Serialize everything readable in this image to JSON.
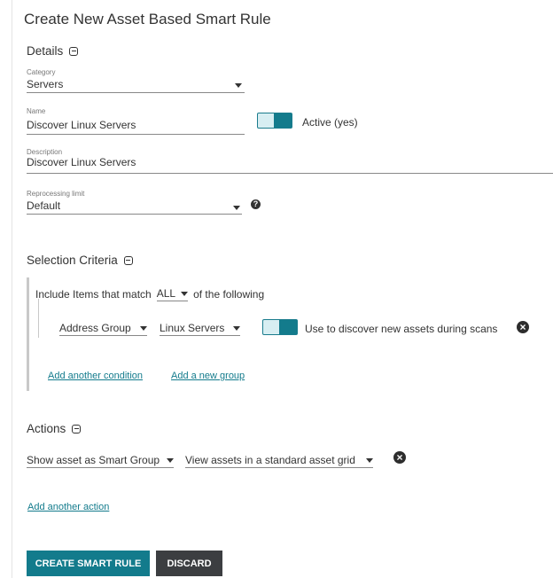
{
  "title": "Create New Asset Based Smart Rule",
  "details": {
    "heading": "Details",
    "category": {
      "label": "Category",
      "value": "Servers"
    },
    "name": {
      "label": "Name",
      "value": "Discover Linux Servers"
    },
    "active_toggle": {
      "label": "Active (yes)",
      "on": true
    },
    "description": {
      "label": "Description",
      "value": "Discover Linux Servers"
    },
    "reprocessing": {
      "label": "Reprocessing limit",
      "value": "Default"
    }
  },
  "selection_criteria": {
    "heading": "Selection Criteria",
    "match_prefix": "Include Items that match",
    "match_value": "ALL",
    "match_suffix": "of the following",
    "condition": {
      "field": "Address Group",
      "value": "Linux Servers",
      "toggle_label": "Use to discover new assets during scans",
      "toggle_on": true
    },
    "add_condition": "Add another condition",
    "add_group": "Add a new group"
  },
  "actions": {
    "heading": "Actions",
    "action_type": "Show asset as Smart Group",
    "action_option": "View assets in a standard asset grid",
    "add_action": "Add another action"
  },
  "buttons": {
    "create": "CREATE SMART RULE",
    "discard": "DISCARD"
  },
  "colors": {
    "accent": "#137b8c",
    "toggle_bg": "#d7eef2",
    "dark_button": "#3c3e41"
  }
}
